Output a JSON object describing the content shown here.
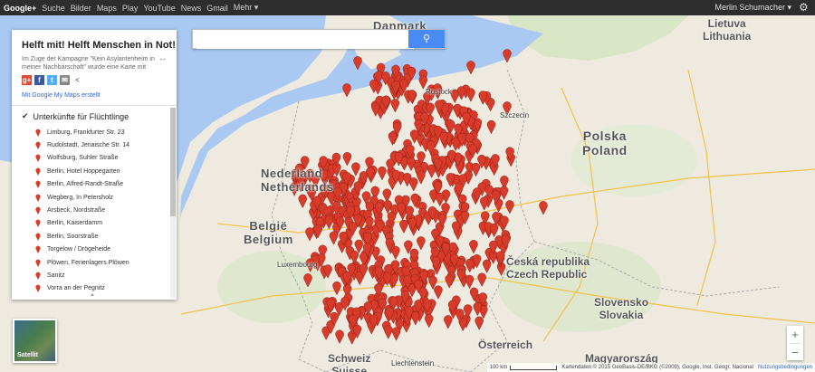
{
  "topbar": {
    "links": [
      "Google+",
      "Suche",
      "Bilder",
      "Maps",
      "Play",
      "YouTube",
      "News",
      "Gmail",
      "Mehr ▾"
    ],
    "user": "Merlin Schumacher ▾"
  },
  "panel": {
    "title": "Helft mit! Helft Menschen in Not!",
    "description": "Im Zuge der Kampagne \"Kein Asylantenheim in meiner Nachbarschaft\" wurde eine Karte mit",
    "made_with": "Mit Google My Maps erstellt",
    "layer_title": "Unterkünfte für Flüchtlinge",
    "items": [
      "Limburg, Frankfurter Str. 23",
      "Rudolstadt, Jenaische Str. 14",
      "Wolfsburg, Suhler Straße",
      "Berlin, Hotel Hoppegarten",
      "Berlin, Alfred-Randt-Straße",
      "Wegberg, In Petersholz",
      "Arsbeck, Nordstraße",
      "Berlin, Kaiserdamm",
      "Berlin, Soorstraße",
      "Torgelow / Drögeheide",
      "Plöwen, Ferienlagers Plöwen",
      "Sanitz",
      "Vorra an der Pegnitz"
    ],
    "share_icons": [
      "google-plus-icon",
      "facebook-icon",
      "twitter-icon",
      "email-icon",
      "share-icon"
    ]
  },
  "map": {
    "labels": {
      "danmark": "Danmark",
      "lithuania": "Lietuva\nLithuania",
      "polska": "Polska\nPoland",
      "nederland": "Nederland\nNetherlands",
      "belgie": "België\nBelgium",
      "luxembourg": "Luxembourg",
      "cesko": "Česká republika\nCzech Republic",
      "slovensko": "Slovensko\nSlovakia",
      "osterreich": "Österreich",
      "schweiz": "Schweiz\nSuisse",
      "magyar": "Magyarország",
      "liechtenstein": "Liechtenstein",
      "szczecin": "Szczecin",
      "rostock": "Rostock"
    },
    "satellite_label": "Satellit",
    "accent_pin_color": "#d93b2b"
  },
  "footer": {
    "scale": "100 km",
    "attribution": "Kartendaten © 2015 GeoBasis-DE/BKG (©2009), Google, Inst. Geogr. Nacional",
    "terms": "Nutzungsbedingungen"
  }
}
